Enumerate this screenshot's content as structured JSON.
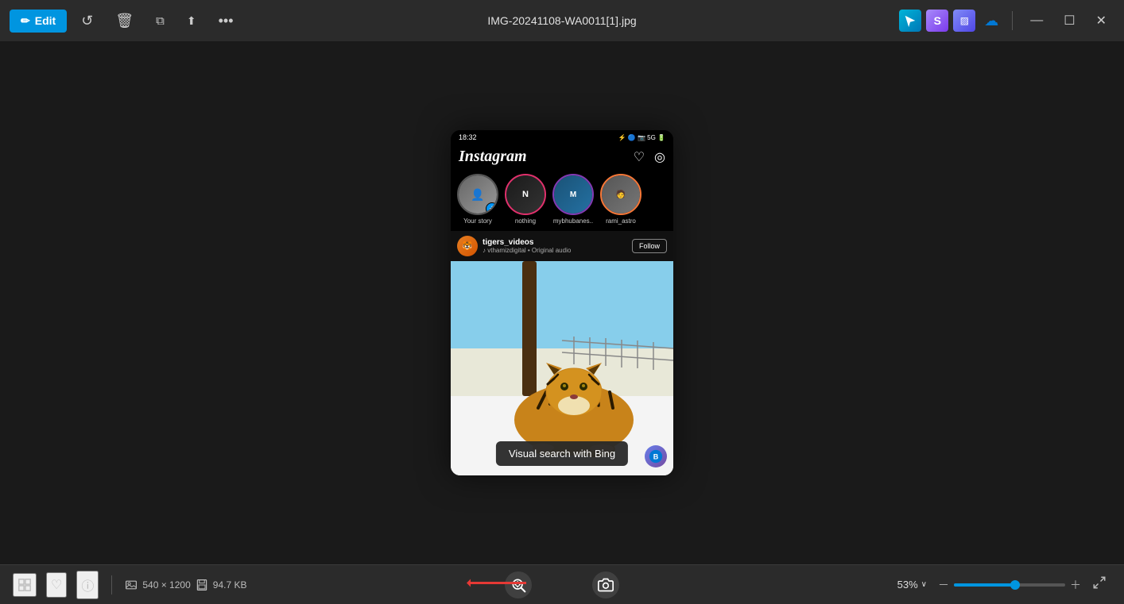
{
  "window": {
    "title": "IMG-20241108-WA0011[1].jpg",
    "min_label": "—",
    "max_label": "☐",
    "close_label": "✕"
  },
  "toolbar": {
    "edit_label": "Edit",
    "rotate_icon": "↺",
    "delete_icon": "🗑",
    "duplicate_icon": "⧉",
    "share_icon": "⬆",
    "more_icon": "•••"
  },
  "system_tray": {
    "icons": [
      "✈",
      "◑",
      "▨",
      "☁"
    ]
  },
  "image_info": {
    "dimensions": "540 × 1200",
    "file_size": "94.7 KB"
  },
  "zoom": {
    "level": "53%",
    "chevron": "∨"
  },
  "instagram": {
    "logo": "Instagram",
    "time": "18:32",
    "username": "tigers_videos",
    "subtitle": "♪ vthamizdigital • Original audio",
    "follow_btn": "Follow",
    "stories": [
      {
        "name": "Your story",
        "type": "your-story"
      },
      {
        "name": "nothing",
        "type": "gradient"
      },
      {
        "name": "mybhubaneswar",
        "type": "gradient"
      },
      {
        "name": "rami_astro",
        "type": "gradient"
      }
    ]
  },
  "tooltip": {
    "label": "Visual search with Bing"
  },
  "bottom_bar": {
    "frame_icon": "⊞",
    "heart_icon": "♡",
    "info_icon": "ⓘ",
    "folder_icon": "🖿",
    "save_icon": "💾",
    "visual_search_icon": "⊕",
    "camera_icon": "📷",
    "zoom_minus": "－",
    "zoom_plus": "＋",
    "expand_icon": "⤢"
  }
}
